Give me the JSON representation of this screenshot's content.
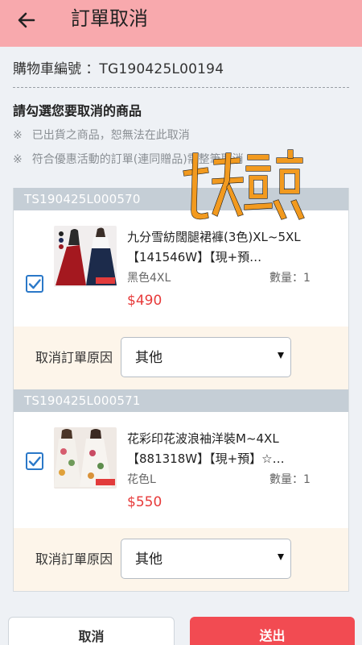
{
  "header": {
    "title": "訂單取消",
    "back_icon": "arrow-left-icon"
  },
  "cart": {
    "label": "購物車編號 ：",
    "number": "TG190425L00194"
  },
  "instructions": {
    "heading": "請勾選您要取消的商品",
    "notes": [
      {
        "mark": "※",
        "text": "已出貨之商品，恕無法在此取消"
      },
      {
        "mark": "※",
        "text": "符合優惠活動的訂單(連同贈品)需整筆取消"
      }
    ]
  },
  "watermark": {
    "text": "七天鑑賞"
  },
  "orders": [
    {
      "id": "TS190425L000570",
      "checked": true,
      "name": "九分雪紡闊腿裙褲(3色)XL~5XL【141546W】【現+預…",
      "spec": "黑色4XL",
      "qty": "數量：1",
      "price": "$490",
      "reason_label": "取消訂單原因",
      "reason_value": "其他"
    },
    {
      "id": "TS190425L000571",
      "checked": true,
      "name": "花彩印花波浪袖洋裝M~4XL【881318W】【現+預】☆…",
      "spec": "花色L",
      "qty": "數量：1",
      "price": "$550",
      "reason_label": "取消訂單原因",
      "reason_value": "其他"
    }
  ],
  "actions": {
    "cancel": "取消",
    "submit": "送出"
  },
  "colors": {
    "header": "#f8a9ad",
    "price": "#e73a3a",
    "submit": "#f24b52",
    "checkbox": "#2a78c8"
  }
}
